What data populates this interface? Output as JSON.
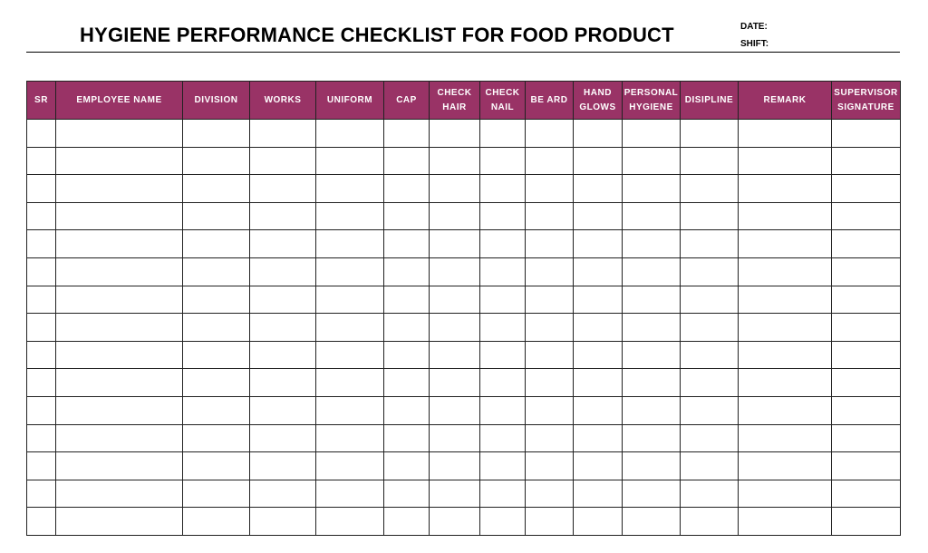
{
  "document": {
    "title": "HYGIENE PERFORMANCE CHECKLIST FOR FOOD PRODUCT",
    "date_label": "DATE:",
    "shift_label": "SHIFT:"
  },
  "table": {
    "header_color": "#993366",
    "columns": [
      {
        "line1": "SR",
        "line2": ""
      },
      {
        "line1": "EMPLOYEE NAME",
        "line2": ""
      },
      {
        "line1": "DIVISION",
        "line2": ""
      },
      {
        "line1": "WORKS",
        "line2": ""
      },
      {
        "line1": "UNIFORM",
        "line2": ""
      },
      {
        "line1": "CAP",
        "line2": ""
      },
      {
        "line1": "CHECK",
        "line2": "HAIR"
      },
      {
        "line1": "CHECK",
        "line2": "NAIL"
      },
      {
        "line1": "BE ARD",
        "line2": ""
      },
      {
        "line1": "HAND",
        "line2": "GLOWS"
      },
      {
        "line1": "PERSONAL",
        "line2": "HYGIENE"
      },
      {
        "line1": "DISIPLINE",
        "line2": ""
      },
      {
        "line1": "REMARK",
        "line2": ""
      },
      {
        "line1": "SUPERVISOR",
        "line2": "SIGNATURE"
      }
    ],
    "row_count": 15
  }
}
